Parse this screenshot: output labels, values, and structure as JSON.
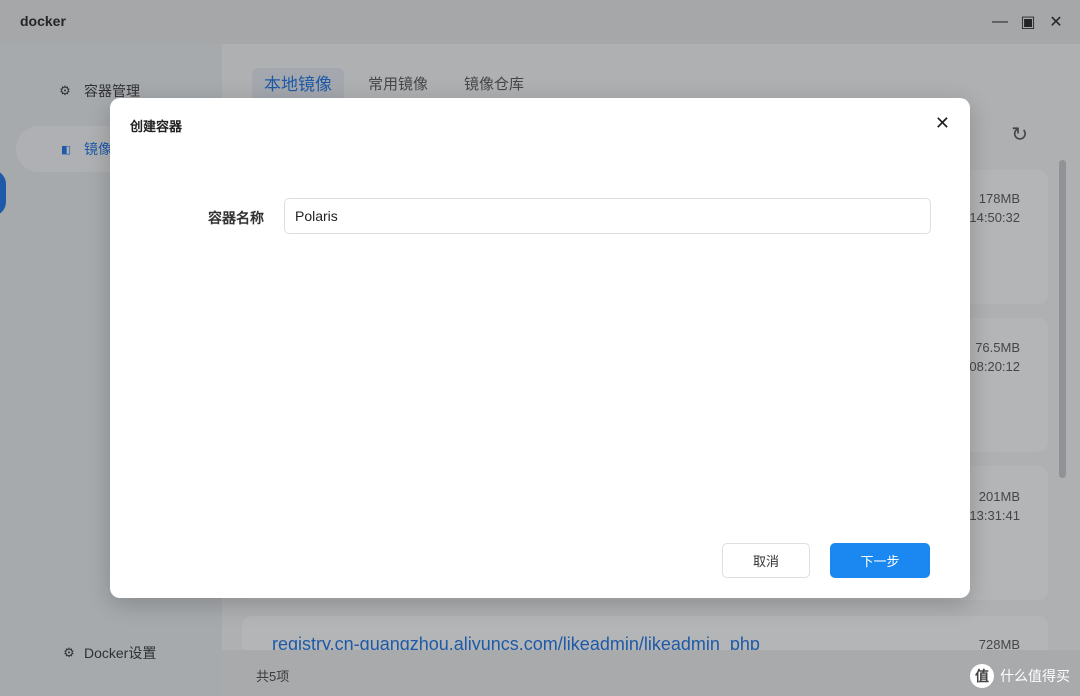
{
  "window": {
    "title": "docker",
    "controls": {
      "minimize": "—",
      "maximize": "▣",
      "close": "✕"
    }
  },
  "sidebar": {
    "items": [
      {
        "label": "容器管理",
        "icon": "gear-icon",
        "glyph": "⚙"
      },
      {
        "label": "镜像",
        "icon": "image-icon",
        "glyph": "▮▯"
      }
    ],
    "settings": {
      "label": "Docker设置",
      "icon": "settings-icon",
      "glyph": "⚙"
    }
  },
  "tabs": [
    {
      "label": "本地镜像",
      "active": true
    },
    {
      "label": "常用镜像",
      "active": false
    },
    {
      "label": "镜像仓库",
      "active": false
    }
  ],
  "refresh_icon": "↻",
  "images": [
    {
      "size": "178MB",
      "time": "14:50:32"
    },
    {
      "size": "76.5MB",
      "time": "08:20:12"
    },
    {
      "size": "201MB",
      "time": "13:31:41"
    },
    {
      "size": "728MB",
      "name": "registry.cn-guangzhou.aliyuncs.com/likeadmin/likeadmin_php"
    }
  ],
  "footer": {
    "count": "共5项"
  },
  "dialog": {
    "title": "创建容器",
    "close": "✕",
    "field_label": "容器名称",
    "field_value": "Polaris",
    "cancel_label": "取消",
    "next_label": "下一步"
  },
  "watermark": {
    "badge": "值",
    "text": "什么值得买"
  },
  "colors": {
    "accent": "#1a73e8",
    "primary_button": "#1a88f0"
  }
}
